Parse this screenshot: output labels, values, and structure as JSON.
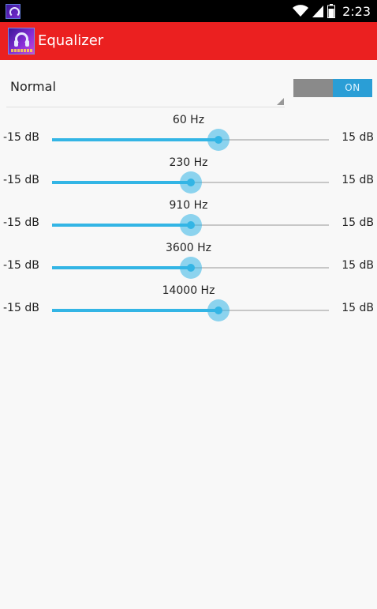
{
  "status_bar": {
    "time": "2:23",
    "icons": [
      "app-notification-icon",
      "wifi-icon",
      "signal-icon",
      "battery-icon"
    ]
  },
  "action_bar": {
    "title": "Equalizer",
    "logo_icon": "headphones-logo-icon",
    "color": "#eb2020"
  },
  "preset": {
    "selected": "Normal"
  },
  "toggle": {
    "label": "ON",
    "state": true
  },
  "accent_color": "#33b5e5",
  "bands": [
    {
      "label": "60 Hz",
      "min_label": "-15 dB",
      "max_label": "15 dB",
      "level": 0.6
    },
    {
      "label": "230 Hz",
      "min_label": "-15 dB",
      "max_label": "15 dB",
      "level": 0.5
    },
    {
      "label": "910 Hz",
      "min_label": "-15 dB",
      "max_label": "15 dB",
      "level": 0.5
    },
    {
      "label": "3600 Hz",
      "min_label": "-15 dB",
      "max_label": "15 dB",
      "level": 0.5
    },
    {
      "label": "14000 Hz",
      "min_label": "-15 dB",
      "max_label": "15 dB",
      "level": 0.6
    }
  ]
}
